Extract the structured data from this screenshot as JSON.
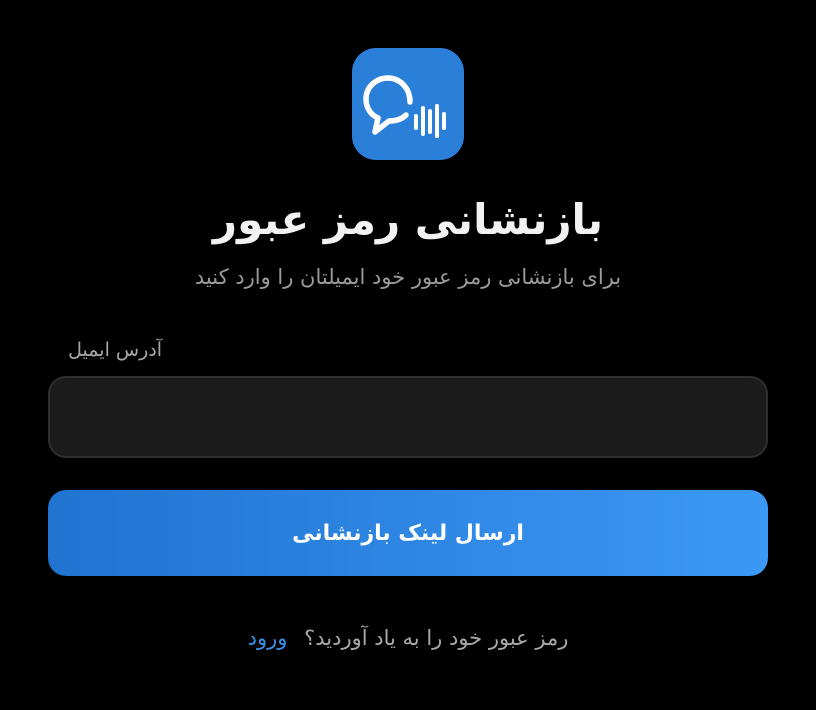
{
  "logo": {
    "icon": "chat-bubble-voice-icon",
    "background_color": "#2a7fd9"
  },
  "header": {
    "title": "بازنشانی رمز عبور",
    "subtitle": "برای بازنشانی رمز عبور خود ایمیلتان را وارد کنید"
  },
  "form": {
    "email_label": "آدرس ایمیل",
    "email_value": "",
    "email_placeholder": "",
    "submit_label": "ارسال لینک بازنشانی"
  },
  "footer": {
    "prompt_text": "رمز عبور خود را به یاد آوردید؟",
    "login_link_label": "ورود"
  },
  "colors": {
    "background": "#000000",
    "accent": "#3a8ee6",
    "button_gradient_start": "#2173d0",
    "button_gradient_end": "#3b99f5",
    "input_background": "#1b1b1b"
  }
}
